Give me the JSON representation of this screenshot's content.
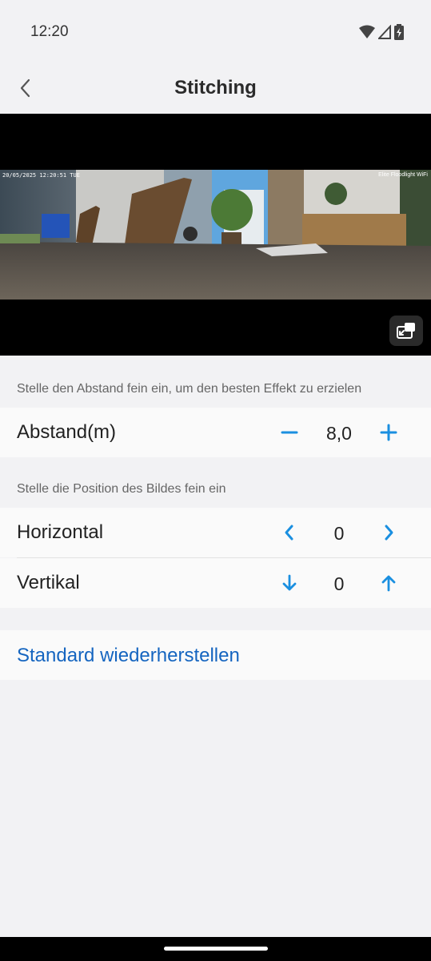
{
  "status_bar": {
    "time": "12:20",
    "icons": [
      "wifi-icon",
      "signal-icon",
      "battery-charging-icon"
    ]
  },
  "header": {
    "title": "Stitching",
    "back_icon": "chevron-left-icon"
  },
  "camera": {
    "timestamp": "20/05/2025 12:20:51 TUE",
    "device_label": "Elite Floodlight WiFi",
    "pip_icon": "picture-in-picture-icon"
  },
  "distance_section": {
    "hint": "Stelle den Abstand fein ein, um den besten Effekt zu erzielen",
    "label": "Abstand(m)",
    "value": "8,0",
    "decrease_icon": "minus-icon",
    "increase_icon": "plus-icon"
  },
  "position_section": {
    "hint": "Stelle die Position des Bildes fein ein",
    "horizontal": {
      "label": "Horizontal",
      "value": "0",
      "left_icon": "chevron-left-icon",
      "right_icon": "chevron-right-icon"
    },
    "vertical": {
      "label": "Vertikal",
      "value": "0",
      "down_icon": "arrow-down-icon",
      "up_icon": "arrow-up-icon"
    }
  },
  "reset": {
    "label": "Standard wiederherstellen"
  },
  "colors": {
    "accent": "#1a8fe0",
    "link": "#1565c0",
    "background": "#f2f2f4",
    "row": "#fafafa"
  }
}
